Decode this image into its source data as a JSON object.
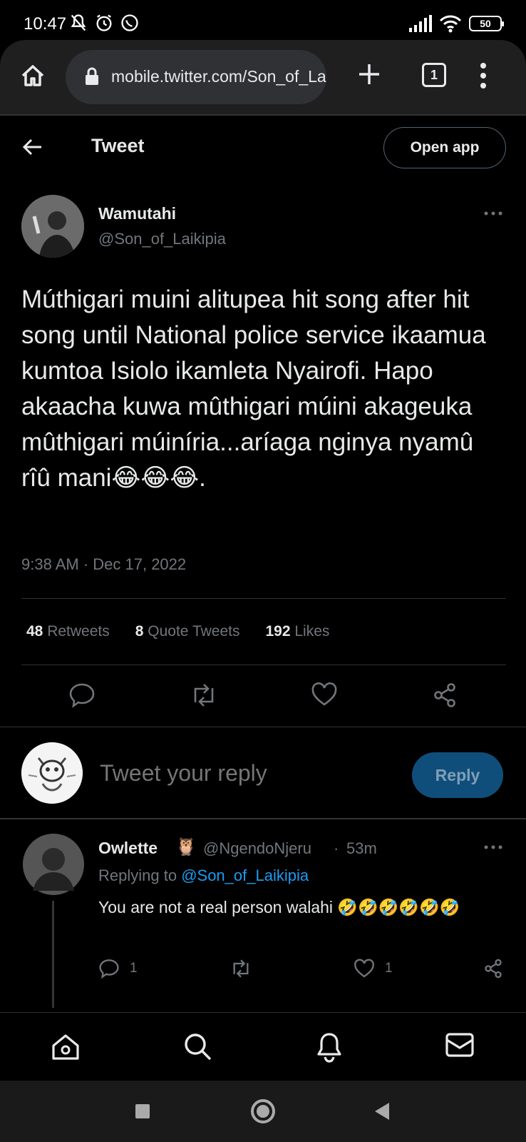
{
  "status_bar": {
    "time": "10:47",
    "battery": "50",
    "icons": [
      "muted-bell-icon",
      "alarm-icon",
      "whatsapp-icon",
      "signal-icon",
      "wifi-icon",
      "battery-icon"
    ]
  },
  "browser": {
    "url": "mobile.twitter.com/Son_of_Laikipia",
    "tab_count": "1"
  },
  "header": {
    "title": "Tweet",
    "open_app": "Open app"
  },
  "tweet": {
    "author_name": "Wamutahi",
    "author_handle": "@Son_of_Laikipia",
    "text": "Múthigari muini alitupea hit song after hit song until National police service ikaamua kumtoa Isiolo ikamleta Nyairofi. Hapo akaacha kuwa mûthigari múini akageuka mûthigari múiníria...aríaga nginya nyamû rîû mani😂😂😂.",
    "timestamp": "9:38 AM · Dec 17, 2022",
    "stats": {
      "retweets_count": "48",
      "retweets_label": "Retweets",
      "quotes_count": "8",
      "quotes_label": "Quote Tweets",
      "likes_count": "192",
      "likes_label": "Likes"
    }
  },
  "composer": {
    "placeholder": "Tweet your reply",
    "reply_button": "Reply"
  },
  "reply": {
    "name": "Owlette",
    "emoji": "🦉",
    "handle": "@NgendoNjeru",
    "separator": "·",
    "age": "53m",
    "replying_prefix": "Replying to ",
    "replying_to": "@Son_of_Laikipia",
    "text": "You are not a real person walahi 🤣🤣🤣🤣🤣🤣",
    "reply_count": "1",
    "like_count": "1"
  },
  "colors": {
    "background": "#000000",
    "accent": "#1d9bf0",
    "muted": "#71767b",
    "reply_button": "#0f4e7a"
  }
}
